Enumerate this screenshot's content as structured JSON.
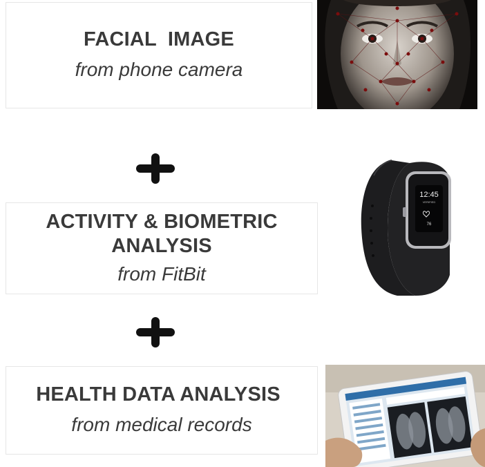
{
  "items": [
    {
      "title": "FACIAL  IMAGE",
      "subtitle": "from phone camera",
      "image_icon": "face-landmarks-photo"
    },
    {
      "title_line1": "ACTIVITY & BIOMETRIC",
      "title_line2": "ANALYSIS",
      "subtitle": "from FitBit",
      "image_icon": "fitness-tracker-photo"
    },
    {
      "title": "HEALTH DATA ANALYSIS",
      "subtitle": "from medical records",
      "image_icon": "tablet-xray-photo"
    }
  ],
  "watch": {
    "time": "12:45",
    "status": "VERIFIED",
    "heart_value": "76"
  },
  "colors": {
    "text": "#3a3a3a",
    "plus": "#111111",
    "box_border": "#e6e6e6"
  }
}
